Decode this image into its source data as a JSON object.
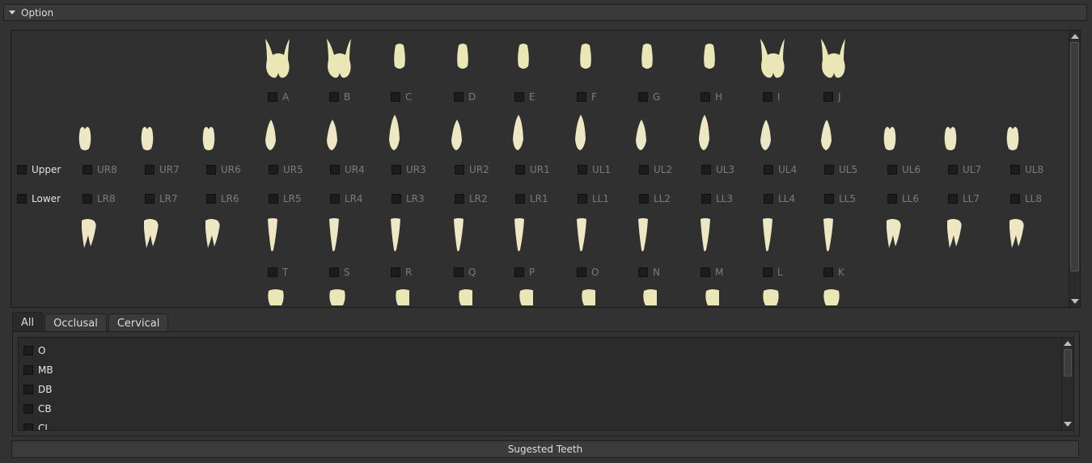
{
  "header": {
    "title": "Option"
  },
  "upper_primary": {
    "labels": [
      "A",
      "B",
      "C",
      "D",
      "E",
      "F",
      "G",
      "H",
      "I",
      "J"
    ]
  },
  "upper_permanent": {
    "row_label": "Upper",
    "labels": [
      "UR8",
      "UR7",
      "UR6",
      "UR5",
      "UR4",
      "UR3",
      "UR2",
      "UR1",
      "UL1",
      "UL2",
      "UL3",
      "UL4",
      "UL5",
      "UL6",
      "UL7",
      "UL8"
    ]
  },
  "lower_permanent": {
    "row_label": "Lower",
    "labels": [
      "LR8",
      "LR7",
      "LR6",
      "LR5",
      "LR4",
      "LR3",
      "LR2",
      "LR1",
      "LL1",
      "LL2",
      "LL3",
      "LL4",
      "LL5",
      "LL6",
      "LL7",
      "LL8"
    ]
  },
  "lower_primary": {
    "labels": [
      "T",
      "S",
      "R",
      "Q",
      "P",
      "O",
      "N",
      "M",
      "L",
      "K"
    ]
  },
  "tabs": [
    {
      "label": "All"
    },
    {
      "label": "Occlusal"
    },
    {
      "label": "Cervical"
    }
  ],
  "surfaces": [
    "O",
    "MB",
    "DB",
    "CB",
    "CL"
  ],
  "actions": {
    "suggest_label": "Sugested Teeth"
  },
  "colors": {
    "tooth": "#eee7c4",
    "tooth_primary": "#ebe6b6",
    "background": "#303030"
  }
}
